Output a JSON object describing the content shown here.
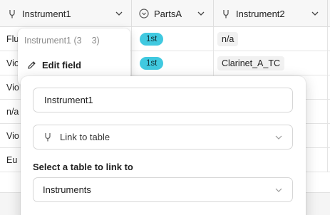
{
  "grid": {
    "columns": [
      {
        "label": "Instrument1",
        "icon": "link-field-icon"
      },
      {
        "label": "PartsA",
        "icon": "single-select-field-icon"
      },
      {
        "label": "Instrument2",
        "icon": "link-field-icon"
      }
    ],
    "rows": [
      {
        "instrument1": "Flu",
        "partsA": "1st",
        "instrument2": "n/a"
      },
      {
        "instrument1": "Vio",
        "partsA": "1st",
        "instrument2": "Clarinet_A_TC"
      },
      {
        "instrument1": "Vio",
        "partsA": "",
        "instrument2": ""
      },
      {
        "instrument1": "n/a",
        "partsA": "",
        "instrument2": ""
      },
      {
        "instrument1": "Vio",
        "partsA": "",
        "instrument2": ""
      },
      {
        "instrument1": "Eu",
        "partsA": "",
        "instrument2": ""
      }
    ]
  },
  "context_menu": {
    "title": "Instrument1 (3",
    "title_suffix": "3)",
    "edit_field_label": "Edit field",
    "edit_icon": "pencil-icon"
  },
  "field_editor": {
    "field_name": "Instrument1",
    "field_type": "Link to table",
    "field_type_icon": "link-field-icon",
    "table_section_label": "Select a table to link to",
    "selected_table": "Instruments"
  },
  "colors": {
    "pill": "#40c9e0",
    "header_bg": "#f7f7f7",
    "chip_bg": "#f1f1f1"
  }
}
